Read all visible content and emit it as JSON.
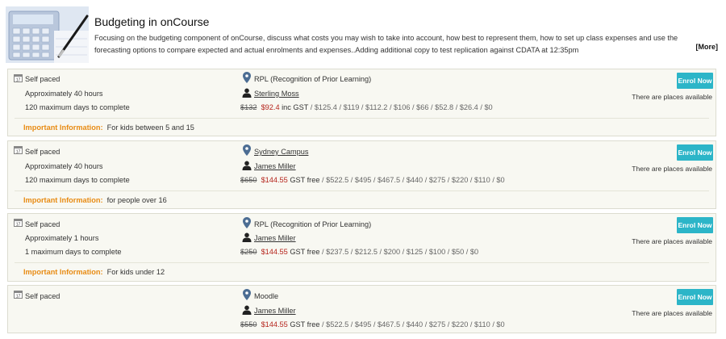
{
  "header": {
    "title": "Budgeting in onCourse",
    "description": "Focusing on the budgeting component of onCourse, discuss what costs you may wish to take into account, how best to represent them, how to set up class expenses and use the forecasting options to compare expected and  actual enrolments and expenses..Adding additional copy to test replication against CDATA at 12:35pm",
    "more_label": "[More]"
  },
  "classes": [
    {
      "mode": "Self paced",
      "duration": "Approximately 40 hours",
      "max_days": "120 maximum days to complete",
      "location": "RPL (Recognition of Prior Learning)",
      "location_link": false,
      "tutor": "Sterling Moss",
      "price_old": "$132",
      "price_current": "$92.4",
      "gst_text": "inc GST",
      "price_rest": " / $125.4 / $119 / $112.2 / $106 / $66 / $52.8 / $26.4 / $0",
      "info_label": "Important Information:",
      "info_text": "For kids between 5 and 15",
      "enrol_label": "Enrol Now",
      "availability": "There are places available"
    },
    {
      "mode": "Self paced",
      "duration": "Approximately 40 hours",
      "max_days": "120 maximum days to complete",
      "location": "Sydney Campus",
      "location_link": true,
      "tutor": "James Miller",
      "price_old": "$650",
      "price_current": "$144.55",
      "gst_text": "GST free",
      "price_rest": " / $522.5 / $495 / $467.5 / $440 / $275 / $220 / $110 / $0",
      "info_label": "Important Information:",
      "info_text": "for people over 16",
      "enrol_label": "Enrol Now",
      "availability": "There are places available"
    },
    {
      "mode": "Self paced",
      "duration": "Approximately 1 hours",
      "max_days": "1 maximum days to complete",
      "location": "RPL (Recognition of Prior Learning)",
      "location_link": false,
      "tutor": "James Miller",
      "price_old": "$250",
      "price_current": "$144.55",
      "gst_text": "GST free",
      "price_rest": " / $237.5 / $212.5 / $200 / $125 / $100 / $50 / $0",
      "info_label": "Important Information:",
      "info_text": "For kids under 12",
      "enrol_label": "Enrol Now",
      "availability": "There are places available"
    },
    {
      "mode": "Self paced",
      "location": "Moodle",
      "location_link": false,
      "tutor": "James Miller",
      "price_old": "$550",
      "price_current": "$144.55",
      "gst_text": "GST free",
      "price_rest": " / $522.5 / $495 / $467.5 / $440 / $275 / $220 / $110 / $0",
      "enrol_label": "Enrol Now",
      "availability": "There are places available"
    }
  ],
  "colors": {
    "accent": "#2cb5c8",
    "price_current": "#b5241c",
    "info_label": "#e88b13",
    "row_background": "#f8f8f2"
  },
  "icons": {
    "calendar": "calendar-icon",
    "location": "map-pin-icon",
    "tutor": "person-icon"
  }
}
